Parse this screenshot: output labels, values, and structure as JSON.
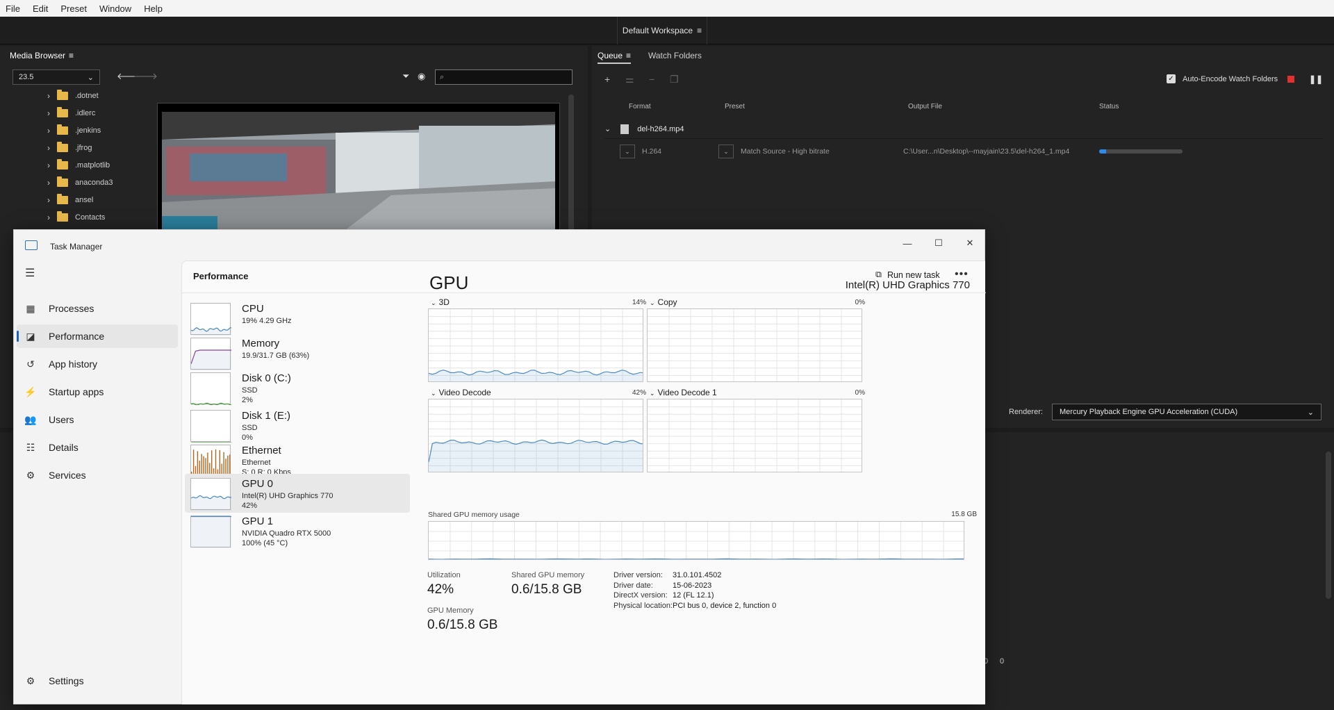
{
  "menu": [
    "File",
    "Edit",
    "Preset",
    "Window",
    "Help"
  ],
  "workspace": "Default Workspace",
  "media_browser": {
    "tab": "Media Browser",
    "folder_select": "23.5",
    "folders": [
      ".dotnet",
      ".idlerc",
      ".jenkins",
      ".jfrog",
      ".matplotlib",
      "anaconda3",
      "ansel",
      "Contacts"
    ]
  },
  "queue": {
    "tabs": [
      "Queue",
      "Watch Folders"
    ],
    "auto_encode": "Auto-Encode Watch Folders",
    "headers": {
      "format": "Format",
      "preset": "Preset",
      "output": "Output File",
      "status": "Status"
    },
    "group_name": "del-h264.mp4",
    "item": {
      "format": "H.264",
      "preset": "Match Source - High bitrate",
      "output": "C:\\User...n\\Desktop\\--mayjain\\23.5\\del-h264_1.mp4",
      "progress_fraction": 0.08
    },
    "renderer_label": "Renderer:",
    "renderer": "Mercury Playback Engine GPU Acceleration (CUDA)"
  },
  "bottom_panel": {
    "value_a": "0",
    "value_b": "0"
  },
  "colors": {
    "accent": "#1a63b8",
    "progress": "#2d8ceb",
    "graph_line": "#4a8ac4",
    "memory_line": "#8a3fa0",
    "disk_line": "#3c9a2c",
    "ethernet_bars": "#b8661e"
  },
  "task_manager": {
    "title": "Task Manager",
    "nav": [
      {
        "label": "Processes",
        "icon": "processes-icon"
      },
      {
        "label": "Performance",
        "icon": "performance-icon"
      },
      {
        "label": "App history",
        "icon": "app-history-icon"
      },
      {
        "label": "Startup apps",
        "icon": "startup-apps-icon"
      },
      {
        "label": "Users",
        "icon": "users-icon"
      },
      {
        "label": "Details",
        "icon": "details-icon"
      },
      {
        "label": "Services",
        "icon": "services-icon"
      }
    ],
    "settings": "Settings",
    "page_title": "Performance",
    "run_new_task": "Run new task",
    "devices": [
      {
        "name": "CPU",
        "line1": "19%  4.29 GHz",
        "line2": ""
      },
      {
        "name": "Memory",
        "line1": "19.9/31.7 GB (63%)",
        "line2": ""
      },
      {
        "name": "Disk 0 (C:)",
        "line1": "SSD",
        "line2": "2%"
      },
      {
        "name": "Disk 1 (E:)",
        "line1": "SSD",
        "line2": "0%"
      },
      {
        "name": "Ethernet",
        "line1": "Ethernet",
        "line2": "S: 0  R: 0 Kbps"
      },
      {
        "name": "GPU 0",
        "line1": "Intel(R) UHD Graphics 770",
        "line2": "42%"
      },
      {
        "name": "GPU 1",
        "line1": "NVIDIA Quadro RTX 5000",
        "line2": "100%  (45 °C)"
      }
    ],
    "gpu": {
      "title": "GPU",
      "model": "Intel(R) UHD Graphics 770",
      "engines": [
        {
          "label": "3D",
          "pct": "14%"
        },
        {
          "label": "Copy",
          "pct": "0%"
        },
        {
          "label": "Video Decode",
          "pct": "42%"
        },
        {
          "label": "Video Decode 1",
          "pct": "0%"
        }
      ],
      "shared_label": "Shared GPU memory usage",
      "shared_max": "15.8 GB",
      "stats": {
        "utilization_label": "Utilization",
        "utilization": "42%",
        "shared_label": "Shared GPU memory",
        "shared": "0.6/15.8 GB",
        "gpu_memory_label": "GPU Memory",
        "gpu_memory": "0.6/15.8 GB"
      },
      "details": [
        {
          "label": "Driver version:",
          "value": "31.0.101.4502"
        },
        {
          "label": "Driver date:",
          "value": "15-06-2023"
        },
        {
          "label": "DirectX version:",
          "value": "12 (FL 12.1)"
        },
        {
          "label": "Physical location:",
          "value": "PCI bus 0, device 2, function 0"
        }
      ]
    }
  }
}
